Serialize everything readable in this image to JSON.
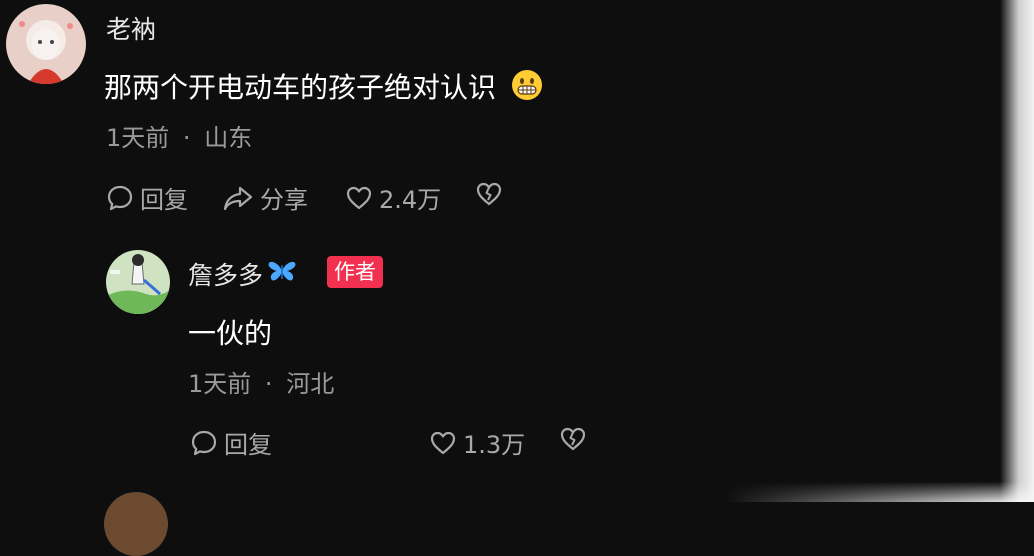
{
  "comment": {
    "username": "老衲",
    "text": "那两个开电动车的孩子绝对认识",
    "emoji": "grinning-face-emoji",
    "time": "1天前",
    "separator": "·",
    "location": "山东",
    "reply_label": "回复",
    "share_label": "分享",
    "likes": "2.4万"
  },
  "reply": {
    "username": "詹多多",
    "username_icon": "butterfly-icon",
    "author_badge": "作者",
    "text": "一伙的",
    "time": "1天前",
    "separator": "·",
    "location": "河北",
    "reply_label": "回复",
    "likes": "1.3万"
  },
  "colors": {
    "background": "#0e0e0e",
    "author_badge": "#f2304f",
    "butterfly": "#4aa8ff",
    "secondary_text": "#9a9a9a"
  }
}
